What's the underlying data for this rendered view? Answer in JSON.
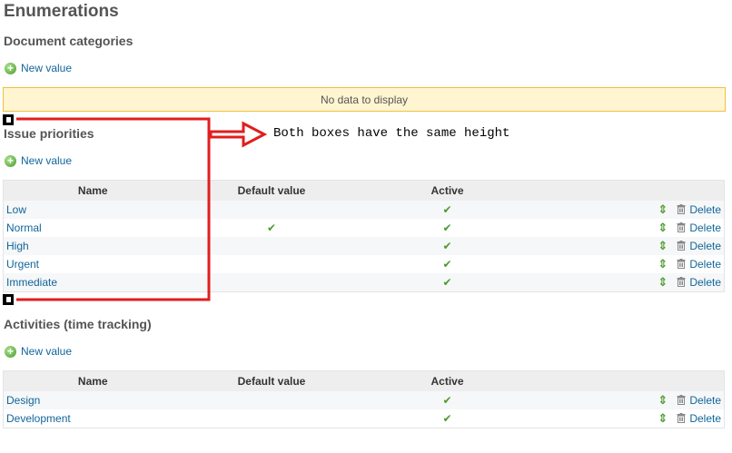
{
  "page": {
    "title": "Enumerations"
  },
  "colors": {
    "link": "#116699",
    "check": "#4d9a2f",
    "annotation_red": "#e01e1e",
    "nodata_bg": "#fff5d1",
    "nodata_border": "#f0c040"
  },
  "sections": {
    "document_categories": {
      "title": "Document categories",
      "new_value": "New value",
      "empty_message": "No data to display"
    },
    "issue_priorities": {
      "title": "Issue priorities",
      "new_value": "New value",
      "headers": {
        "name": "Name",
        "default": "Default value",
        "active": "Active"
      },
      "rows": [
        {
          "name": "Low",
          "default": "",
          "active": "✔",
          "delete": "Delete"
        },
        {
          "name": "Normal",
          "default": "✔",
          "active": "✔",
          "delete": "Delete"
        },
        {
          "name": "High",
          "default": "",
          "active": "✔",
          "delete": "Delete"
        },
        {
          "name": "Urgent",
          "default": "",
          "active": "✔",
          "delete": "Delete"
        },
        {
          "name": "Immediate",
          "default": "",
          "active": "✔",
          "delete": "Delete"
        }
      ]
    },
    "activities": {
      "title": "Activities (time tracking)",
      "new_value": "New value",
      "headers": {
        "name": "Name",
        "default": "Default value",
        "active": "Active"
      },
      "rows": [
        {
          "name": "Design",
          "default": "",
          "active": "✔",
          "delete": "Delete"
        },
        {
          "name": "Development",
          "default": "",
          "active": "✔",
          "delete": "Delete"
        }
      ]
    }
  },
  "annotation": {
    "text": "Both boxes have the same height"
  },
  "icons": {
    "plus": "plus-circle-icon",
    "check": "check-icon",
    "sort": "sort-arrows-icon",
    "trash": "trash-icon"
  },
  "glyphs": {
    "plus": "+",
    "sort": "⇕"
  }
}
